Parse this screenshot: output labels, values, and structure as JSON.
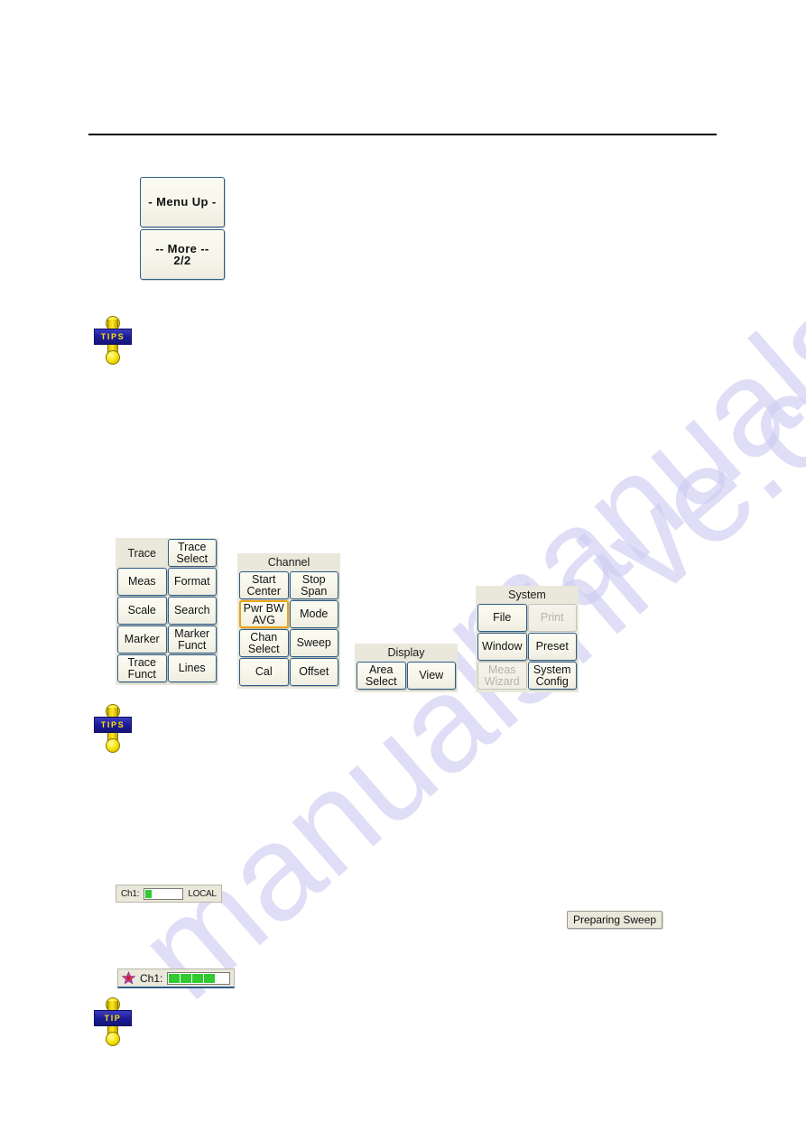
{
  "page": {
    "watermark": "manualshive.com"
  },
  "menu_buttons": [
    {
      "name": "menu-up",
      "line1": "- Menu Up -",
      "line2": ""
    },
    {
      "name": "more",
      "line1": "-- More --",
      "line2": "2/2"
    }
  ],
  "tips": [
    {
      "label": "TIPS"
    },
    {
      "label": "TIPS"
    },
    {
      "label": "TIP"
    }
  ],
  "key_groups": [
    {
      "id": "trace",
      "title": "",
      "keys": [
        {
          "type": "label",
          "line1": "Trace",
          "line2": "",
          "state": "normal"
        },
        {
          "type": "button",
          "line1": "Trace",
          "line2": "Select",
          "state": "normal"
        },
        {
          "type": "button",
          "line1": "Meas",
          "line2": "",
          "state": "normal"
        },
        {
          "type": "button",
          "line1": "Format",
          "line2": "",
          "state": "normal"
        },
        {
          "type": "button",
          "line1": "Scale",
          "line2": "",
          "state": "normal"
        },
        {
          "type": "button",
          "line1": "Search",
          "line2": "",
          "state": "normal"
        },
        {
          "type": "button",
          "line1": "Marker",
          "line2": "",
          "state": "normal"
        },
        {
          "type": "button",
          "line1": "Marker",
          "line2": "Funct",
          "state": "normal"
        },
        {
          "type": "button",
          "line1": "Trace",
          "line2": "Funct",
          "state": "normal"
        },
        {
          "type": "button",
          "line1": "Lines",
          "line2": "",
          "state": "normal"
        }
      ]
    },
    {
      "id": "channel",
      "title": "Channel",
      "keys": [
        {
          "type": "button",
          "line1": "Start",
          "line2": "Center",
          "state": "normal"
        },
        {
          "type": "button",
          "line1": "Stop",
          "line2": "Span",
          "state": "normal"
        },
        {
          "type": "button",
          "line1": "Pwr BW",
          "line2": "AVG",
          "state": "selected"
        },
        {
          "type": "button",
          "line1": "Mode",
          "line2": "",
          "state": "normal"
        },
        {
          "type": "button",
          "line1": "Chan",
          "line2": "Select",
          "state": "normal"
        },
        {
          "type": "button",
          "line1": "Sweep",
          "line2": "",
          "state": "normal"
        },
        {
          "type": "button",
          "line1": "Cal",
          "line2": "",
          "state": "normal"
        },
        {
          "type": "button",
          "line1": "Offset",
          "line2": "",
          "state": "normal"
        }
      ]
    },
    {
      "id": "display",
      "title": "Display",
      "keys": [
        {
          "type": "button",
          "line1": "Area",
          "line2": "Select",
          "state": "normal"
        },
        {
          "type": "button",
          "line1": "View",
          "line2": "",
          "state": "normal"
        }
      ]
    },
    {
      "id": "system",
      "title": "System",
      "keys": [
        {
          "type": "button",
          "line1": "File",
          "line2": "",
          "state": "normal"
        },
        {
          "type": "button",
          "line1": "Print",
          "line2": "",
          "state": "disabled"
        },
        {
          "type": "button",
          "line1": "Window",
          "line2": "",
          "state": "normal"
        },
        {
          "type": "button",
          "line1": "Preset",
          "line2": "",
          "state": "normal"
        },
        {
          "type": "button",
          "line1": "Meas",
          "line2": "Wizard",
          "state": "disabled"
        },
        {
          "type": "button",
          "line1": "System",
          "line2": "Config",
          "state": "normal"
        }
      ]
    }
  ],
  "status_local": {
    "channel_label": "Ch1:",
    "progress_blocks": 1,
    "progress_total": 5,
    "mode": "LOCAL"
  },
  "status_ch1": {
    "channel_label": "Ch1:",
    "progress_blocks": 4,
    "progress_total": 5,
    "star_color": "#c03fa8",
    "star_center_color": "#d41a1a"
  },
  "status_sweep": {
    "text": "Preparing Sweep"
  },
  "colors": {
    "key_border": "#2d5d86",
    "key_face": "#f7f6ea",
    "panel_face": "#e9e8da",
    "selected_border": "#e8a317",
    "disabled_text": "#b4b4ac",
    "progress_green": "#2fcb2f",
    "tips_band": "#1d1d9c",
    "tips_text": "#ffe400",
    "watermark": "#cdcbf2"
  }
}
